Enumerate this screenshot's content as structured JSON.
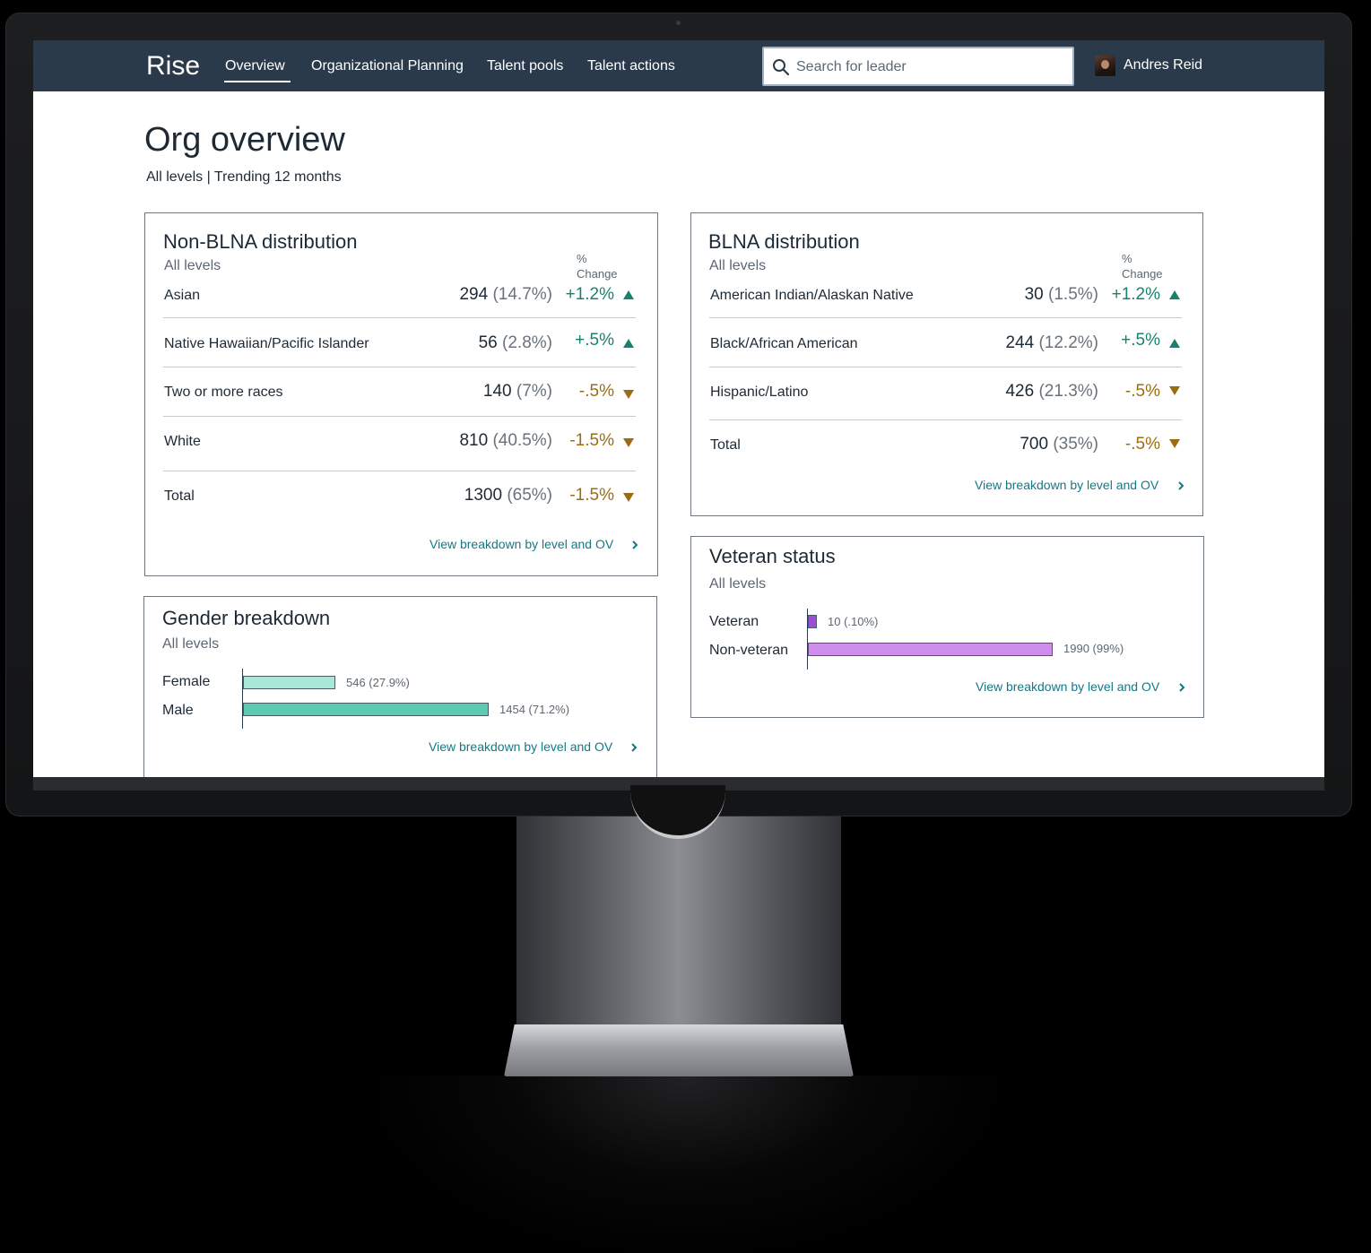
{
  "app": {
    "brand": "Rise",
    "nav": [
      {
        "label": "Overview",
        "active": true
      },
      {
        "label": "Organizational Planning",
        "active": false
      },
      {
        "label": "Talent pools",
        "active": false
      },
      {
        "label": "Talent actions",
        "active": false
      }
    ],
    "search": {
      "placeholder": "Search for leader",
      "value": ""
    },
    "user": {
      "name": "Andres Reid"
    }
  },
  "page": {
    "title": "Org overview",
    "subtitle": "All levels | Trending 12 months"
  },
  "colors": {
    "nav_bg": "#2b3a4a",
    "positive": "#17826e",
    "negative": "#9a6d12",
    "link": "#137985",
    "female_bar": "#a8e6d6",
    "male_bar": "#5ccbb0",
    "veteran_bar": "#9a4fd6",
    "non_veteran_bar": "#cf8eed"
  },
  "non_blna": {
    "title": "Non-BLNA distribution",
    "subtitle": "All levels",
    "pct_header_1": "%",
    "pct_header_2": "Change",
    "rows": [
      {
        "label": "Asian",
        "count": "294",
        "pct": "(14.7%)",
        "change": "+1.2%",
        "direction": "up"
      },
      {
        "label": "Native Hawaiian/Pacific Islander",
        "count": "56",
        "pct": "(2.8%)",
        "change": "+.5%",
        "direction": "up"
      },
      {
        "label": "Two or more races",
        "count": "140",
        "pct": "(7%)",
        "change": "-.5%",
        "direction": "down"
      },
      {
        "label": "White",
        "count": "810",
        "pct": "(40.5%)",
        "change": "-1.5%",
        "direction": "down"
      },
      {
        "label": "Total",
        "count": "1300",
        "pct": "(65%)",
        "change": "-1.5%",
        "direction": "down"
      }
    ],
    "link": "View breakdown by level and OV"
  },
  "blna": {
    "title": "BLNA distribution",
    "subtitle": "All levels",
    "pct_header_1": "%",
    "pct_header_2": "Change",
    "rows": [
      {
        "label": "American Indian/Alaskan Native",
        "count": "30",
        "pct": "(1.5%)",
        "change": "+1.2%",
        "direction": "up"
      },
      {
        "label": "Black/African American",
        "count": "244",
        "pct": "(12.2%)",
        "change": "+.5%",
        "direction": "up"
      },
      {
        "label": "Hispanic/Latino",
        "count": "426",
        "pct": "(21.3%)",
        "change": "-.5%",
        "direction": "down"
      },
      {
        "label": "Total",
        "count": "700",
        "pct": "(35%)",
        "change": "-.5%",
        "direction": "down"
      }
    ],
    "link": "View breakdown by level and OV"
  },
  "gender": {
    "title": "Gender breakdown",
    "subtitle": "All levels",
    "bars": [
      {
        "label": "Female",
        "value": 546,
        "value_label": "546 (27.9%)"
      },
      {
        "label": "Male",
        "value": 1454,
        "value_label": "1454 (71.2%)"
      }
    ],
    "link": "View breakdown by level and OV"
  },
  "veteran": {
    "title": "Veteran status",
    "subtitle": "All levels",
    "bars": [
      {
        "label": "Veteran",
        "value": 10,
        "value_label": "10 (.10%)"
      },
      {
        "label": "Non-veteran",
        "value": 1990,
        "value_label": "1990 (99%)"
      }
    ],
    "link": "View breakdown by level and OV"
  }
}
